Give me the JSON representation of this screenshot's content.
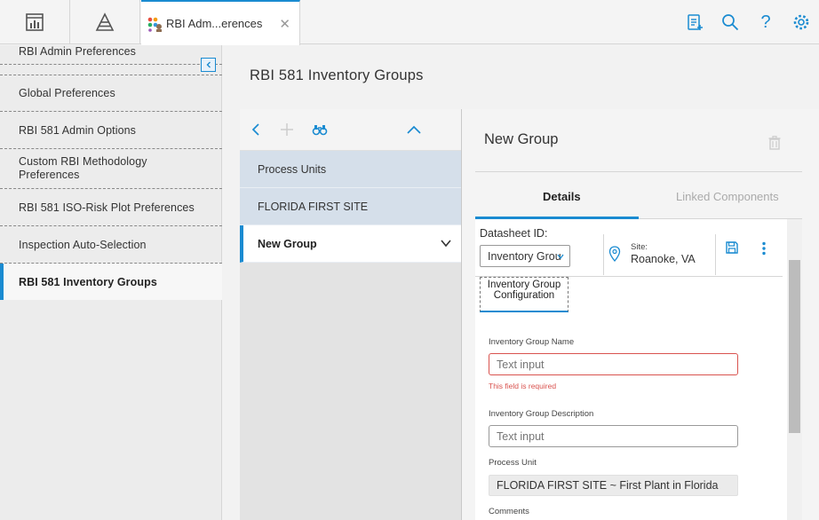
{
  "tabs": {
    "active_label": "RBI Adm...erences"
  },
  "icons": {
    "dashboard": "dashboard-icon",
    "asset": "pyramid-icon",
    "app": "rbi-app-icon",
    "close": "close-icon",
    "clipboard": "clipboard-add-icon",
    "search": "search-icon",
    "help": "help-icon",
    "settings": "gear-icon"
  },
  "sidebar": {
    "items": [
      {
        "label": "RBI Admin Preferences"
      },
      {
        "label": "Global Preferences"
      },
      {
        "label": "RBI 581 Admin Options"
      },
      {
        "label": "Custom RBI Methodology Preferences"
      },
      {
        "label": "RBI 581 ISO-Risk Plot Preferences"
      },
      {
        "label": "Inspection Auto-Selection"
      },
      {
        "label": "RBI 581 Inventory Groups"
      }
    ],
    "active_index": 6
  },
  "page": {
    "title": "RBI 581 Inventory Groups"
  },
  "list": {
    "items": [
      {
        "label": "Process Units"
      },
      {
        "label": "FLORIDA FIRST SITE"
      },
      {
        "label": "New Group"
      }
    ]
  },
  "detail": {
    "title": "New Group",
    "tabs": [
      {
        "label": "Details"
      },
      {
        "label": "Linked Components"
      }
    ],
    "datasheet_label": "Datasheet ID:",
    "datasheet_value": "Inventory Grou",
    "site_label": "Site:",
    "site_value": "Roanoke, VA",
    "config_button": "Inventory Group Configuration",
    "fields": {
      "name_label": "Inventory Group Name",
      "name_placeholder": "Text input",
      "name_error": "This field is required",
      "desc_label": "Inventory Group Description",
      "desc_placeholder": "Text input",
      "process_label": "Process Unit",
      "process_value": "FLORIDA FIRST SITE ~ First Plant in Florida",
      "comments_label": "Comments"
    }
  },
  "colors": {
    "accent": "#1a8bd1",
    "error": "#d9534f",
    "list_selected_bg": "#d5dfea"
  }
}
